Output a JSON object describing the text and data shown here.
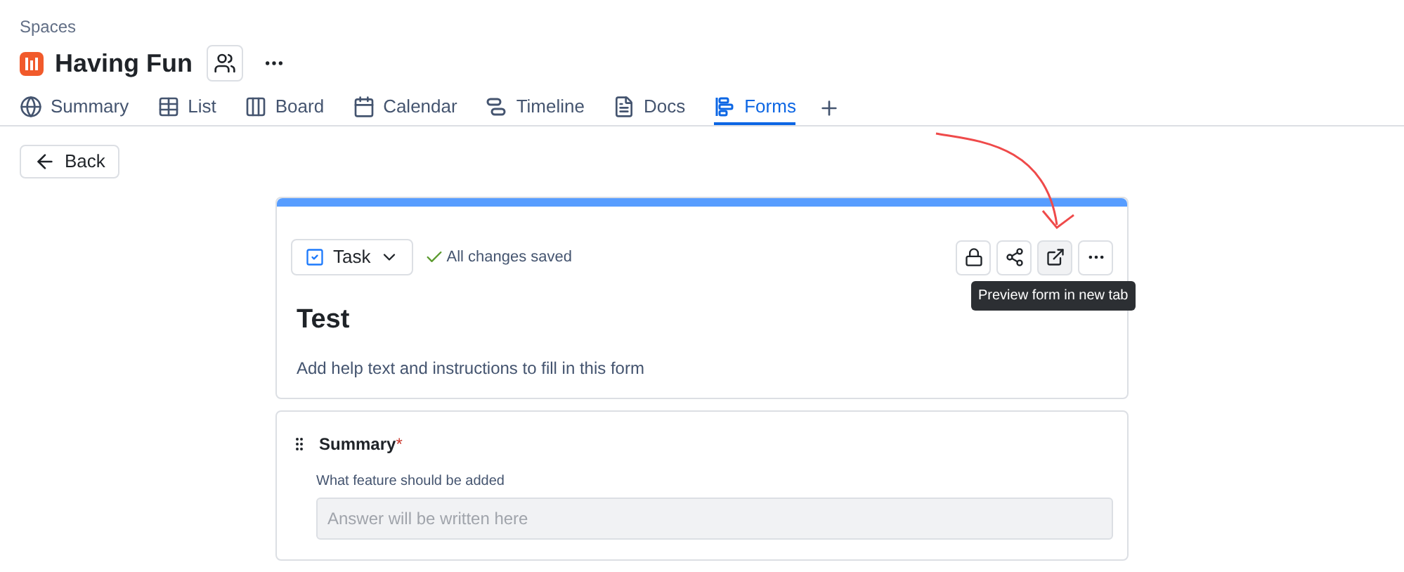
{
  "breadcrumb": "Spaces",
  "space": {
    "title": "Having Fun"
  },
  "tabs": [
    {
      "label": "Summary",
      "kind": "globe",
      "selected": false
    },
    {
      "label": "List",
      "kind": "list",
      "selected": false
    },
    {
      "label": "Board",
      "kind": "board",
      "selected": false
    },
    {
      "label": "Calendar",
      "kind": "calendar",
      "selected": false
    },
    {
      "label": "Timeline",
      "kind": "timeline",
      "selected": false
    },
    {
      "label": "Docs",
      "kind": "docs",
      "selected": false
    },
    {
      "label": "Forms",
      "kind": "forms",
      "selected": true
    }
  ],
  "back_button": "Back",
  "form": {
    "type_select": "Task",
    "save_status": "All changes saved",
    "tooltip": "Preview form in new tab",
    "title": "Test",
    "description": "Add help text and instructions to fill in this form",
    "fields": [
      {
        "label": "Summary",
        "required": true,
        "required_mark": "*",
        "help": "What feature should be added",
        "placeholder": "Answer will be written here"
      }
    ]
  }
}
